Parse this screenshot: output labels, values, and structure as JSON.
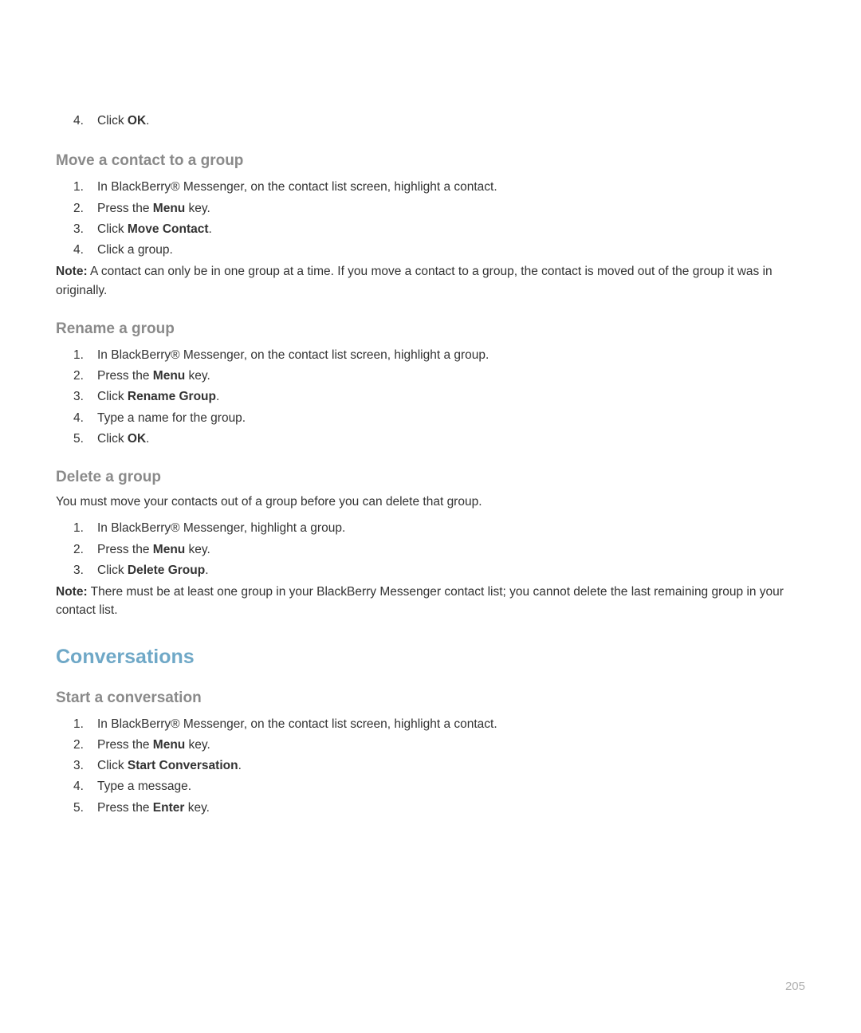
{
  "top_list": {
    "item4_num": "4.",
    "item4_pre": "Click ",
    "item4_bold": "OK",
    "item4_post": "."
  },
  "move": {
    "title": "Move a contact to a group",
    "s1_num": "1.",
    "s1": "In BlackBerry® Messenger, on the contact list screen, highlight a contact.",
    "s2_num": "2.",
    "s2_pre": "Press the ",
    "s2_bold": "Menu",
    "s2_post": " key.",
    "s3_num": "3.",
    "s3_pre": "Click ",
    "s3_bold": "Move Contact",
    "s3_post": ".",
    "s4_num": "4.",
    "s4": "Click a group.",
    "note_label": "Note:",
    "note_body": "  A contact can only be in one group at a time. If you move a contact to a group, the contact is moved out of the group it was in originally."
  },
  "rename": {
    "title": "Rename a group",
    "s1_num": "1.",
    "s1": "In BlackBerry® Messenger, on the contact list screen, highlight a group.",
    "s2_num": "2.",
    "s2_pre": "Press the ",
    "s2_bold": "Menu",
    "s2_post": " key.",
    "s3_num": "3.",
    "s3_pre": "Click ",
    "s3_bold": "Rename Group",
    "s3_post": ".",
    "s4_num": "4.",
    "s4": "Type a name for the group.",
    "s5_num": "5.",
    "s5_pre": "Click ",
    "s5_bold": "OK",
    "s5_post": "."
  },
  "delete": {
    "title": "Delete a group",
    "intro": "You must move your contacts out of a group before you can delete that group.",
    "s1_num": "1.",
    "s1": "In BlackBerry® Messenger, highlight a group.",
    "s2_num": "2.",
    "s2_pre": "Press the ",
    "s2_bold": "Menu",
    "s2_post": " key.",
    "s3_num": "3.",
    "s3_pre": "Click ",
    "s3_bold": "Delete Group",
    "s3_post": ".",
    "note_label": "Note:",
    "note_body": "  There must be at least one group in your BlackBerry Messenger contact list; you cannot delete the last remaining group in your contact list."
  },
  "conversations": {
    "title": "Conversations"
  },
  "start": {
    "title": "Start a conversation",
    "s1_num": "1.",
    "s1": "In BlackBerry® Messenger, on the contact list screen, highlight a contact.",
    "s2_num": "2.",
    "s2_pre": "Press the ",
    "s2_bold": "Menu",
    "s2_post": " key.",
    "s3_num": "3.",
    "s3_pre": "Click ",
    "s3_bold": "Start Conversation",
    "s3_post": ".",
    "s4_num": "4.",
    "s4": "Type a message.",
    "s5_num": "5.",
    "s5_pre": "Press the ",
    "s5_bold": "Enter",
    "s5_post": " key."
  },
  "page_number": "205"
}
